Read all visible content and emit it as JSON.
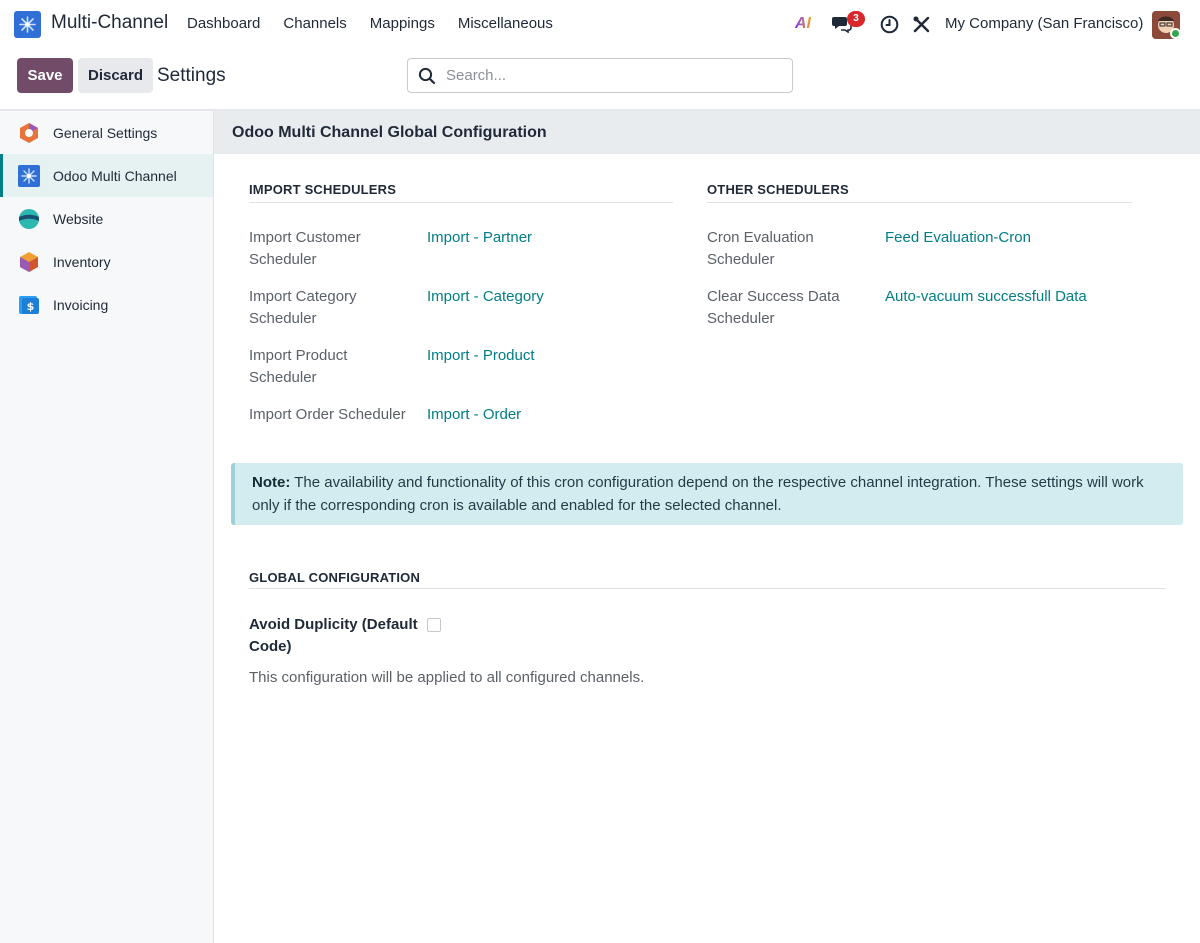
{
  "navbar": {
    "app_name": "Multi-Channel",
    "menu": [
      "Dashboard",
      "Channels",
      "Mappings",
      "Miscellaneous"
    ],
    "ai_label": "AI",
    "messages_count": "3",
    "company": "My Company (San Francisco)"
  },
  "control": {
    "save_label": "Save",
    "discard_label": "Discard",
    "breadcrumb": "Settings",
    "search_placeholder": "Search..."
  },
  "sidebar": {
    "items": [
      {
        "label": "General Settings",
        "icon": "odoo-icon"
      },
      {
        "label": "Odoo Multi Channel",
        "icon": "multi-channel-icon",
        "active": true
      },
      {
        "label": "Website",
        "icon": "website-icon"
      },
      {
        "label": "Inventory",
        "icon": "inventory-icon"
      },
      {
        "label": "Invoicing",
        "icon": "invoicing-icon"
      }
    ]
  },
  "main": {
    "section_title": "Odoo Multi Channel Global Configuration",
    "import_schedulers": {
      "title": "IMPORT SCHEDULERS",
      "rows": [
        {
          "label": "Import Customer Scheduler",
          "value": "Import - Partner"
        },
        {
          "label": "Import Category Scheduler",
          "value": "Import - Category"
        },
        {
          "label": "Import Product Scheduler",
          "value": "Import - Product"
        },
        {
          "label": "Import Order Scheduler",
          "value": "Import - Order"
        }
      ]
    },
    "other_schedulers": {
      "title": "OTHER SCHEDULERS",
      "rows": [
        {
          "label": "Cron Evaluation Scheduler",
          "value": "Feed Evaluation-Cron"
        },
        {
          "label": "Clear Success Data Scheduler",
          "value": "Auto-vacuum successfull Data"
        }
      ]
    },
    "note": {
      "prefix": "Note:",
      "text": "The availability and functionality of this cron configuration depend on the respective channel integration. These settings will work only if the corresponding cron is available and enabled for the selected channel."
    },
    "global_config": {
      "title": "GLOBAL CONFIGURATION",
      "field_label": "Avoid Duplicity (Default Code)",
      "checked": false,
      "help": "This configuration will be applied to all configured channels."
    }
  },
  "colors": {
    "brand": "#714b67",
    "link": "#017e84",
    "note_bg": "#d3ecef"
  }
}
